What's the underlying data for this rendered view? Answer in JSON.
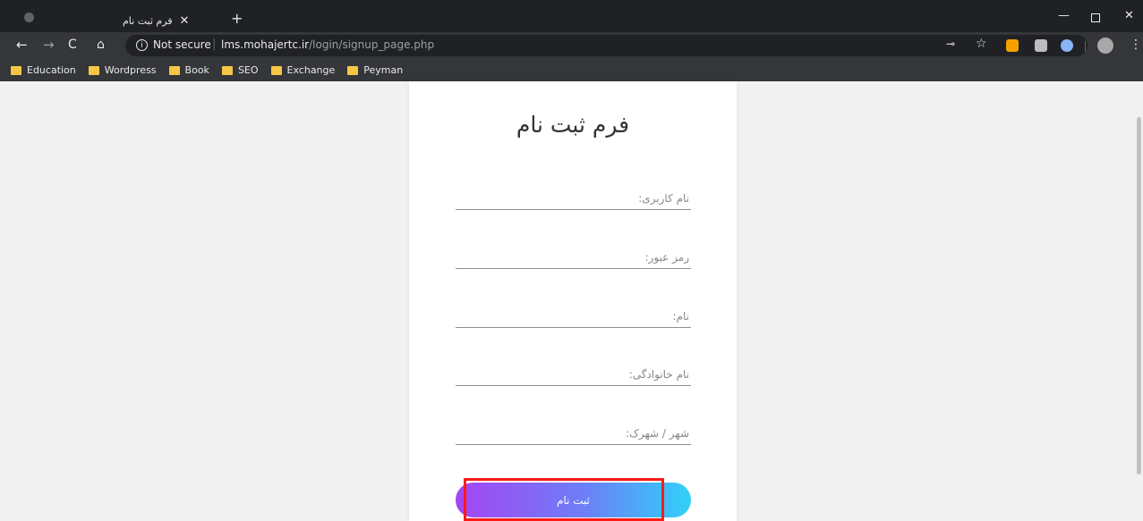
{
  "browser": {
    "tab_title": "فرم ثبت نام",
    "tab_close": "✕",
    "new_tab": "+",
    "window_min": "—",
    "window_close": "✕",
    "back": "←",
    "forward": "→",
    "reload": "C",
    "home": "⌂",
    "info": "i",
    "security_label": "Not secure",
    "separator": "|",
    "url_host": "lms.mohajertc.ir",
    "url_path": "/login/signup_page.php",
    "key": "⊸",
    "star": "☆",
    "menu": "⋮"
  },
  "bookmarks": [
    {
      "label": "Education"
    },
    {
      "label": "Wordpress"
    },
    {
      "label": "Book"
    },
    {
      "label": "SEO"
    },
    {
      "label": "Exchange"
    },
    {
      "label": "Peyman"
    }
  ],
  "form": {
    "title": "فرم ثبت نام",
    "fields": {
      "username_placeholder": "نام کاربری:",
      "password_placeholder": "رمز عبور:",
      "first_name_placeholder": "نام:",
      "last_name_placeholder": "نام خانوادگی:",
      "city_placeholder": "شهر / شهرک:"
    },
    "submit_label": "ثبت نام"
  },
  "colors": {
    "highlight": "#ff1a1a",
    "button_gradient_start": "#a445f2",
    "button_gradient_end": "#2fd2f7"
  }
}
